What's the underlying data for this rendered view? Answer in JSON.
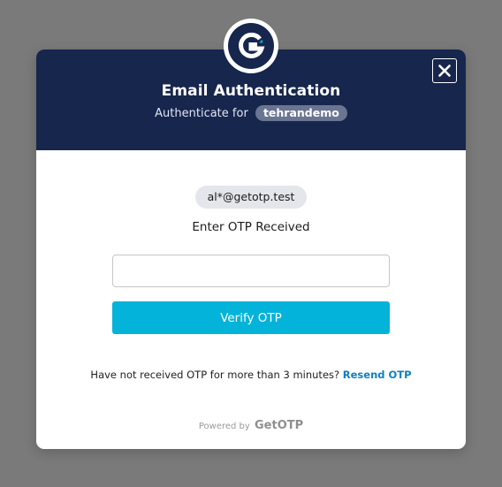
{
  "header": {
    "title": "Email Authentication",
    "subtitle": "Authenticate for",
    "app_name": "tehrandemo",
    "logo_icon": "getotp-logo-icon",
    "close_icon": "close-icon"
  },
  "body": {
    "email": "al*@getotp.test",
    "otp_label": "Enter OTP Received",
    "otp_value": "",
    "otp_placeholder": "",
    "verify_label": "Verify OTP",
    "resend_prompt": "Have not received OTP for more than 3 minutes?",
    "resend_link": "Resend OTP"
  },
  "footer": {
    "powered_by": "Powered by",
    "brand": "GetOTP"
  },
  "colors": {
    "overlay": "#7a7a7a",
    "header_bg": "#16264d",
    "accent": "#04b3d9",
    "link": "#0d7fc0"
  }
}
